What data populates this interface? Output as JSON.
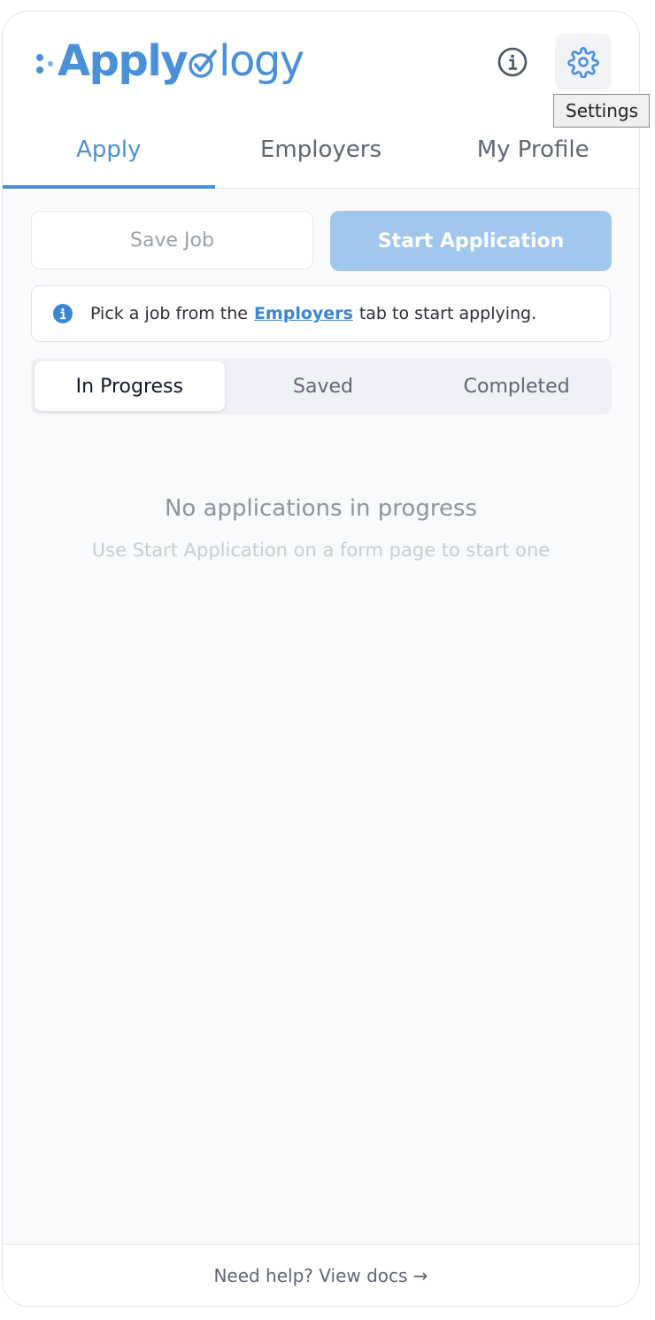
{
  "header": {
    "logo_text_start": "Apply",
    "logo_text_end": "logy",
    "info_icon": "info-icon",
    "settings_icon": "gear-icon",
    "tooltip": "Settings"
  },
  "tabs": [
    {
      "label": "Apply",
      "active": true
    },
    {
      "label": "Employers",
      "active": false
    },
    {
      "label": "My Profile",
      "active": false
    }
  ],
  "actions": {
    "save_job_label": "Save Job",
    "start_application_label": "Start Application"
  },
  "notice": {
    "icon": "info-circle-icon",
    "text_before": "Pick a job from the",
    "link_text": "Employers",
    "text_after": "tab to start applying."
  },
  "segments": [
    {
      "label": "In Progress",
      "active": true
    },
    {
      "label": "Saved",
      "active": false
    },
    {
      "label": "Completed",
      "active": false
    }
  ],
  "empty_state": {
    "title": "No applications in progress",
    "subtitle": "Use Start Application on a form page to start one"
  },
  "footer": {
    "help_text": "Need help? View docs →"
  },
  "colors": {
    "brand": "#4a90d9",
    "start_button": "#a1c7ec",
    "panel_background": "#f8fafc"
  }
}
